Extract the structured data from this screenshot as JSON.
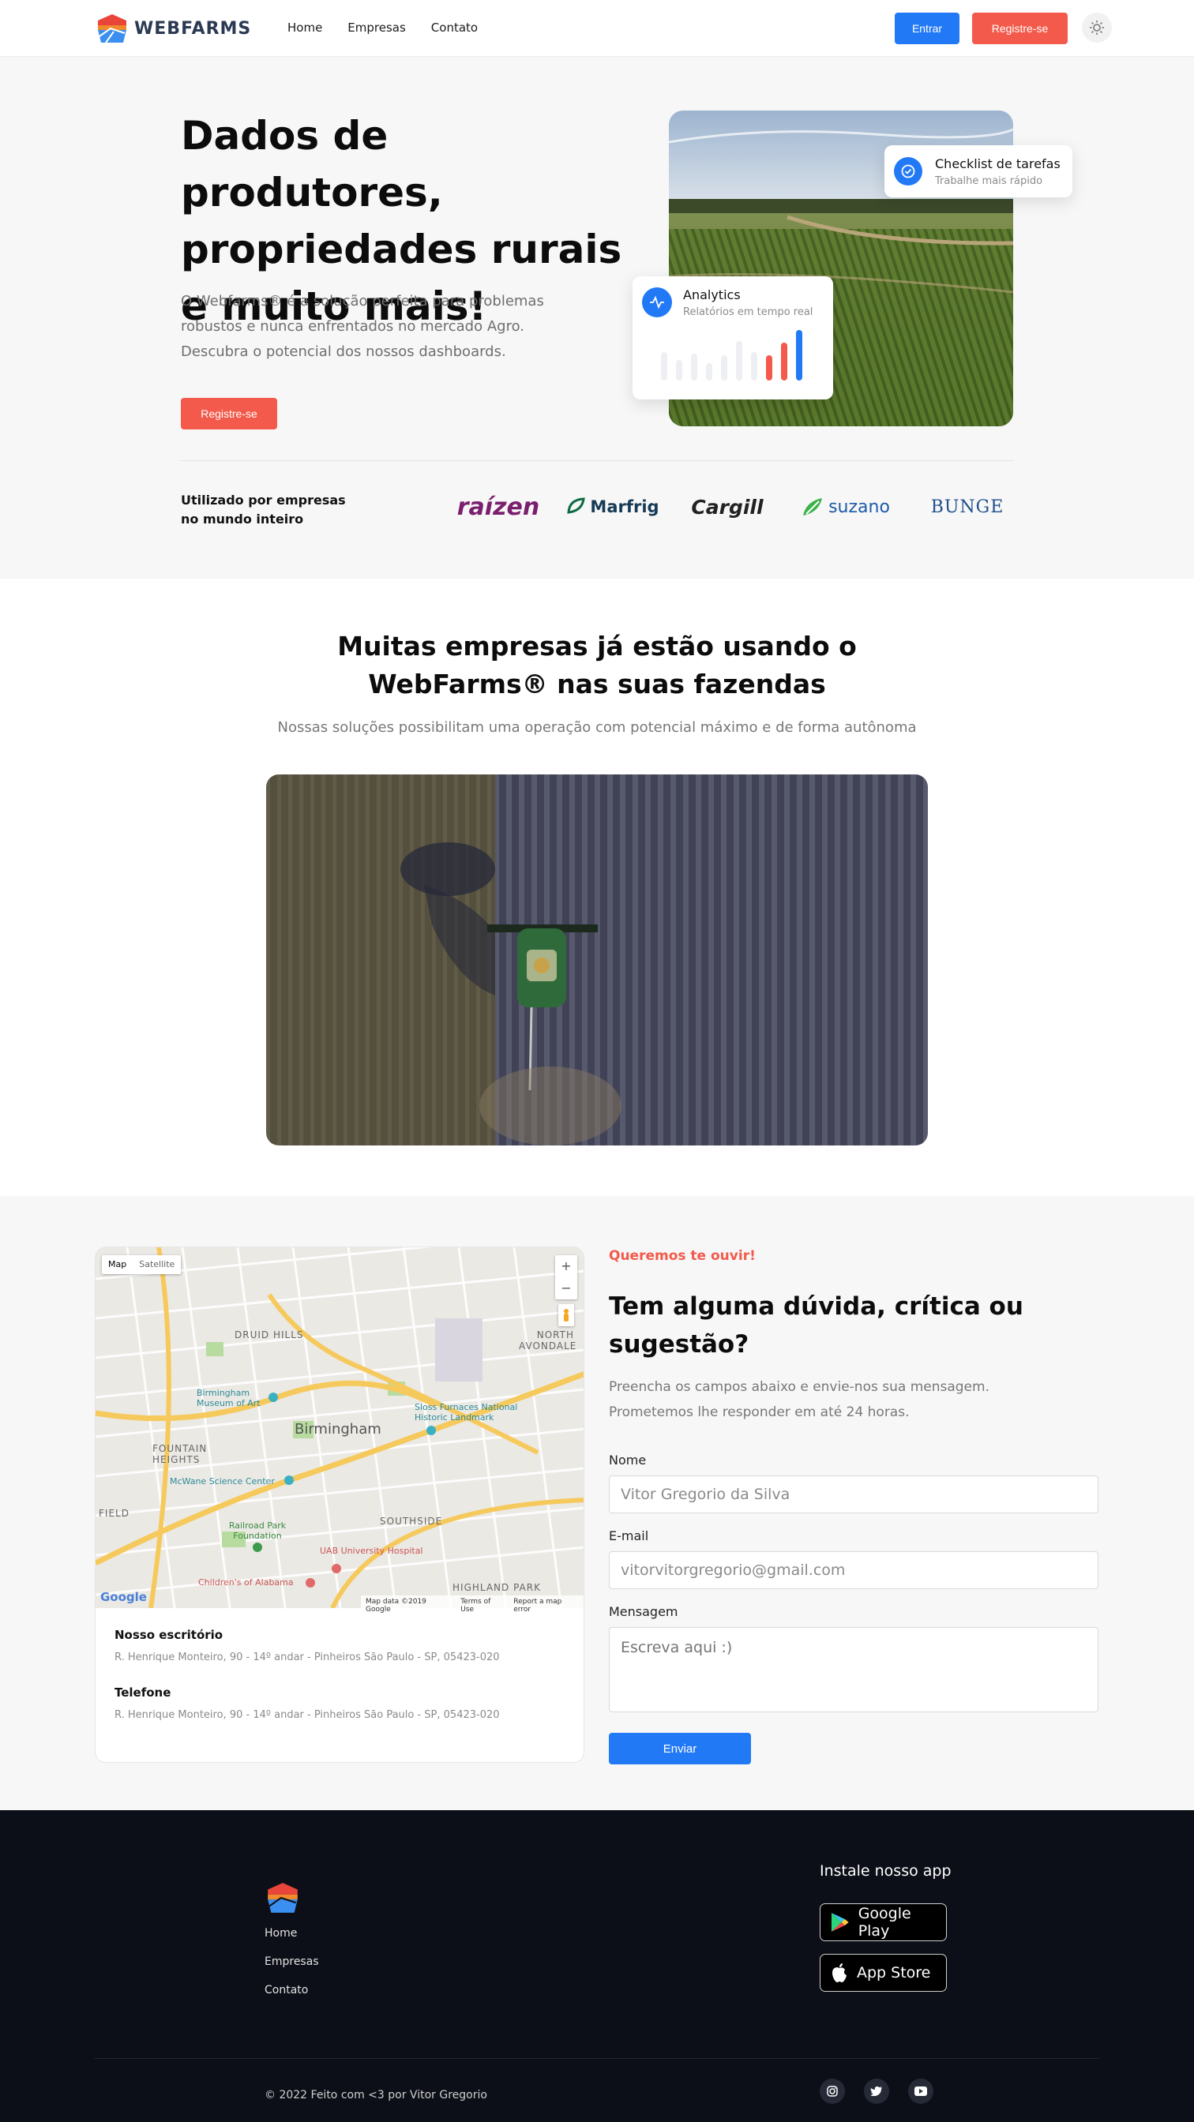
{
  "nav": {
    "logo_text": "WEBFARMS",
    "links": [
      "Home",
      "Empresas",
      "Contato"
    ],
    "login_label": "Entrar",
    "register_label": "Registre-se",
    "theme_icon": "sun-icon"
  },
  "hero": {
    "title": "Dados de produtores, propriedades rurais e muito mais!",
    "description": "O Webfarms® é a solução perfeita para problemas robustos e nunca enfrentados no mercado Agro. Descubra o potencial dos nossos dashboards.",
    "cta_label": "Registre-se",
    "checklist_card": {
      "title": "Checklist de tarefas",
      "subtitle": "Trabalhe mais rápido",
      "icon": "check-circle-icon"
    },
    "analytics_card": {
      "title": "Analytics",
      "subtitle": "Relatórios em tempo real",
      "icon": "pulse-icon"
    },
    "used_by": "Utilizado por empresas no mundo inteiro",
    "brands": [
      "raízen",
      "Marfrig",
      "Cargill",
      "suzano",
      "BUNGE"
    ]
  },
  "showcase": {
    "title": "Muitas empresas já estão usando o WebFarms® nas suas fazendas",
    "subtitle": "Nossas soluções possibilitam uma operação com potencial máximo e de forma autônoma"
  },
  "contact": {
    "map": {
      "tab_map": "Map",
      "tab_satellite": "Satellite",
      "zoom_in": "+",
      "zoom_out": "−",
      "city": "Birmingham",
      "attribution": "Map data ©2019 Google",
      "terms": "Terms of Use",
      "report": "Report a map error",
      "google": "Google",
      "labels": {
        "druid_hills": "DRUID HILLS",
        "fountain_heights": "FOUNTAIN HEIGHTS",
        "southside": "SOUTHSIDE",
        "highland_park": "HIGHLAND PARK",
        "north_avondale": "NORTH AVONDALE",
        "field": "FIELD",
        "museum": "Birmingham Museum of Art",
        "sloss": "Sloss Furnaces National Historic Landmark",
        "mcwane": "McWane Science Center",
        "railroad": "Railroad Park Foundation",
        "uab": "UAB University Hospital",
        "childrens": "Children's of Alabama"
      }
    },
    "office_title": "Nosso escritório",
    "office_address": "R. Henrique Monteiro, 90 - 14º andar - Pinheiros São Paulo - SP, 05423-020",
    "phone_title": "Telefone",
    "phone_value": "R. Henrique Monteiro, 90 - 14º andar - Pinheiros São Paulo - SP, 05423-020",
    "kicker": "Queremos te ouvir!",
    "title": "Tem alguma dúvida, crítica ou sugestão?",
    "description": "Preencha os campos abaixo e envie-nos sua mensagem. Prometemos lhe responder em até 24 horas.",
    "form": {
      "name_label": "Nome",
      "name_value": "Vitor Gregorio da Silva",
      "email_label": "E-mail",
      "email_value": "vitorvitorgregorio@gmail.com",
      "message_label": "Mensagem",
      "message_placeholder": "Escreva aqui :)",
      "submit_label": "Enviar"
    }
  },
  "footer": {
    "links": [
      "Home",
      "Empresas",
      "Contato"
    ],
    "app_title": "Instale nosso app",
    "google_play": "Google Play",
    "app_store": "App Store",
    "copyright": "© 2022 Feito com <3 por Vitor Gregorio",
    "social": [
      "instagram-icon",
      "twitter-icon",
      "youtube-icon"
    ]
  }
}
